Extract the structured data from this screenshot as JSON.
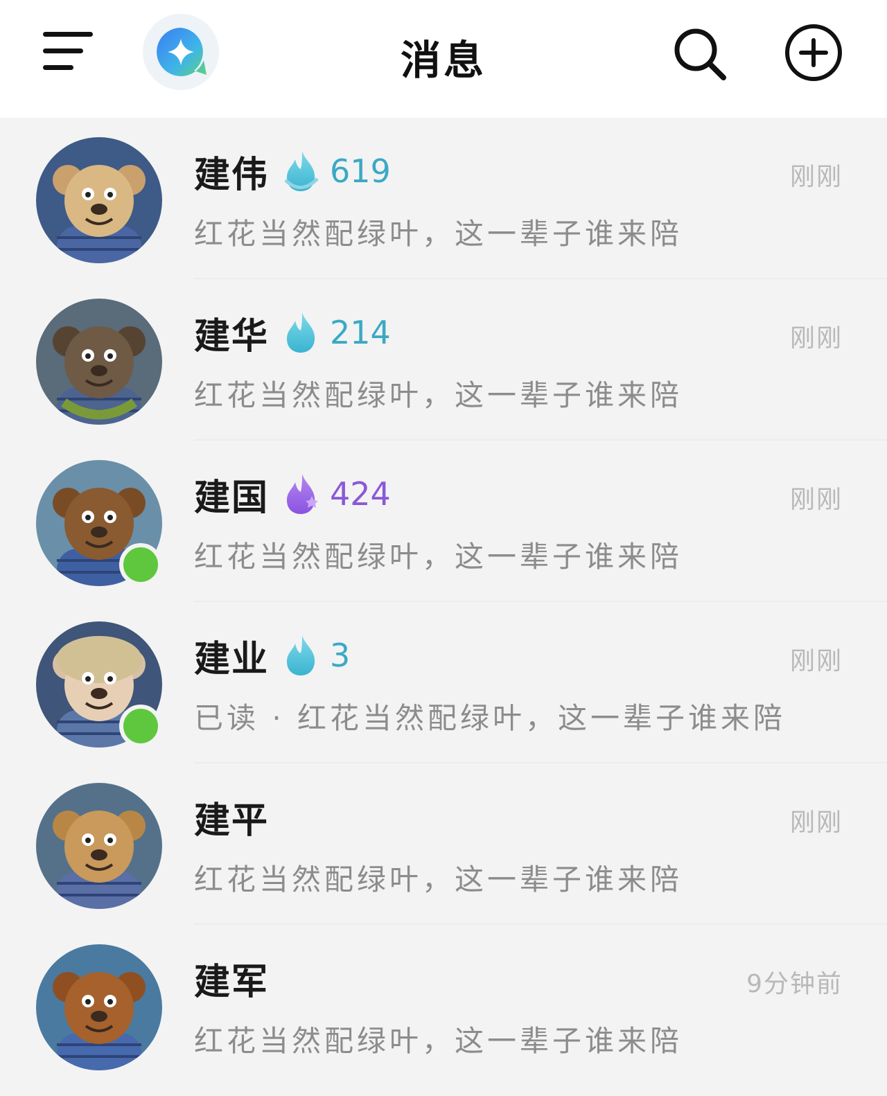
{
  "header": {
    "title": "消息",
    "menu_icon": "menu-icon",
    "ai_icon": "ai-assistant-icon",
    "search_icon": "search-icon",
    "add_icon": "plus-circle-icon"
  },
  "colors": {
    "flame_teal": "#49c1d8",
    "flame_purple": "#9a63e4",
    "streak_teal": "#3aa9c4",
    "streak_purple": "#8a58d8",
    "online": "#5ec73e"
  },
  "conversations": [
    {
      "name": "建伟",
      "streak": "619",
      "flame": "teal-ringed",
      "time": "刚刚",
      "preview": "红花当然配绿叶，这一辈子谁来陪",
      "online": false,
      "avatar": "monkey"
    },
    {
      "name": "建华",
      "streak": "214",
      "flame": "teal",
      "time": "刚刚",
      "preview": "红花当然配绿叶，这一辈子谁来陪",
      "online": false,
      "avatar": "gorilla"
    },
    {
      "name": "建国",
      "streak": "424",
      "flame": "purple",
      "time": "刚刚",
      "preview": "红花当然配绿叶，这一辈子谁来陪",
      "online": true,
      "avatar": "bear-brown"
    },
    {
      "name": "建业",
      "streak": "3",
      "flame": "teal",
      "time": "刚刚",
      "preview": "已读 · 红花当然配绿叶，这一辈子谁来陪",
      "online": true,
      "avatar": "man-hat"
    },
    {
      "name": "建平",
      "streak": "",
      "flame": "",
      "time": "刚刚",
      "preview": "红花当然配绿叶，这一辈子谁来陪",
      "online": false,
      "avatar": "bear-tan"
    },
    {
      "name": "建军",
      "streak": "",
      "flame": "",
      "time": "9分钟前",
      "preview": "红花当然配绿叶，这一辈子谁来陪",
      "online": false,
      "avatar": "bear-orange"
    }
  ]
}
